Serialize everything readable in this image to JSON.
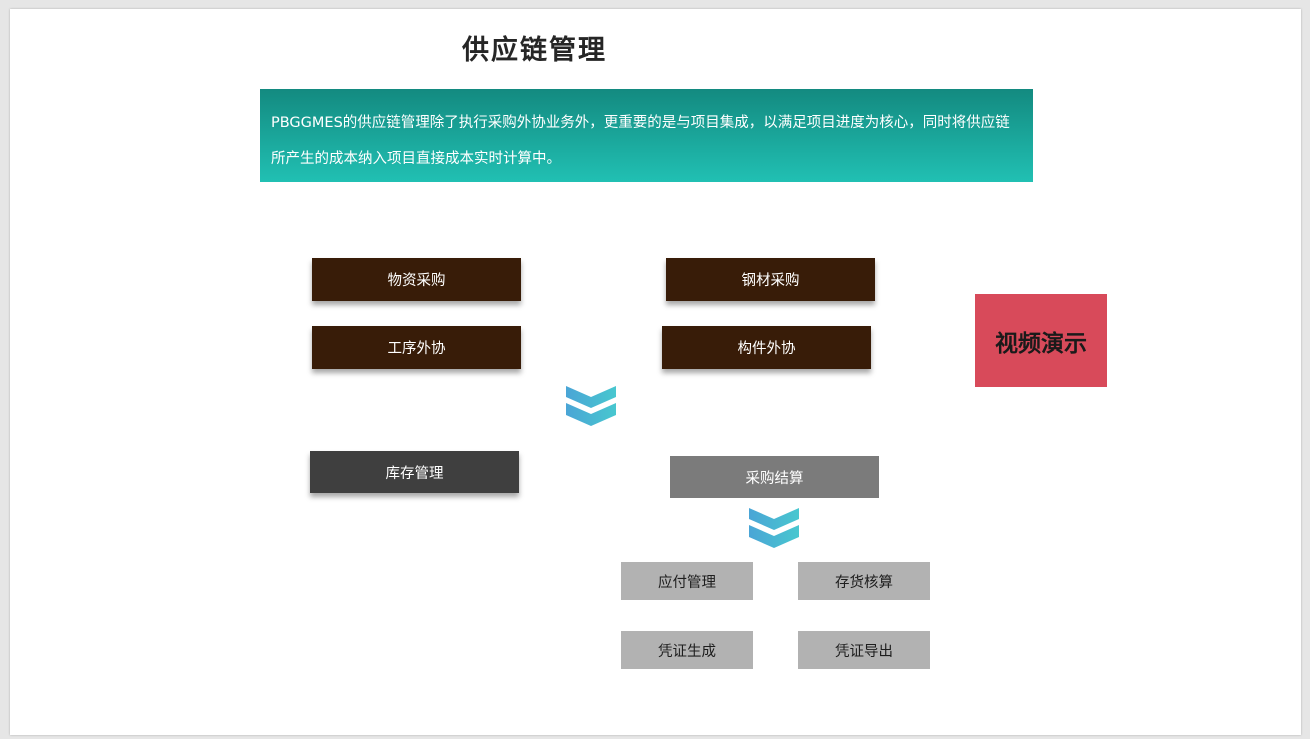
{
  "title": "供应链管理",
  "description": {
    "line1": "PBGGMES的供应链管理除了执行采购外协业务外，更重要的是与项目集成，以满足项目进度为核心，同时将供应链",
    "line2": "所产生的成本纳入项目直接成本实时计算中。"
  },
  "boxes": {
    "material_purchase": "物资采购",
    "steel_purchase": "钢材采购",
    "process_outsourcing": "工序外协",
    "component_outsourcing": "构件外协",
    "inventory": "库存管理",
    "purchase_settlement": "采购结算",
    "payables": "应付管理",
    "inventory_accounting": "存货核算",
    "voucher_generate": "凭证生成",
    "voucher_export": "凭证导出"
  },
  "video_button": "视频演示",
  "colors": {
    "dark_box": "#381c08",
    "dark_gray_box": "#3f3f3f",
    "gray_box": "#7b7b7b",
    "light_box": "#b2b2b2",
    "video_button": "#d84a5a",
    "teal_top": "#138a80",
    "teal_bottom": "#21c0b3",
    "chevron_blue": "#4aa5d6",
    "chevron_teal": "#48c7cf"
  },
  "icons": {
    "chevron": "double-chevron-down-icon"
  }
}
